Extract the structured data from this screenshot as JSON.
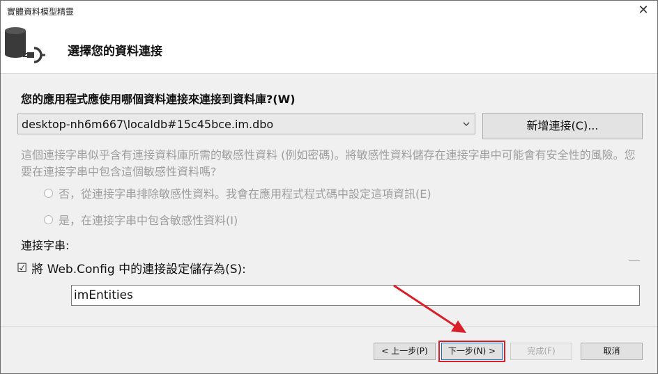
{
  "window": {
    "title": "實體資料模型精靈",
    "close_glyph": "✕"
  },
  "header": {
    "title": "選擇您的資料連接",
    "icon": "database-plug-icon"
  },
  "connection": {
    "question": "您的應用程式應使用哪個資料連接來連接到資料庫?(W)",
    "selected": "desktop-nh6m667\\localdb#15c45bce.im.dbo",
    "new_connection_label": "新增連接(C)..."
  },
  "sensitive": {
    "description": "這個連接字串似乎含有連接資料庫所需的敏感性資料 (例如密碼)。將敏感性資料儲存在連接字串中可能會有安全性的風險。您要在連接字串中包含這個敏感性資料嗎?",
    "option_exclude": "否，從連接字串排除敏感性資料。我會在應用程式程式碼中設定這項資訊(E)",
    "option_include": "是，在連接字串中包含敏感性資料(I)"
  },
  "connection_string": {
    "label": "連接字串:"
  },
  "save": {
    "checked_glyph": "☑",
    "label": "將 Web.Config 中的連接設定儲存為(S):",
    "entity_name": "imEntities"
  },
  "footer": {
    "prev_label": "< 上一步(P)",
    "next_label": "下一步(N) >",
    "finish_label": "完成(F)",
    "cancel_label": "取消"
  },
  "colors": {
    "annotation": "#d9202a",
    "accent": "#0078d7"
  }
}
